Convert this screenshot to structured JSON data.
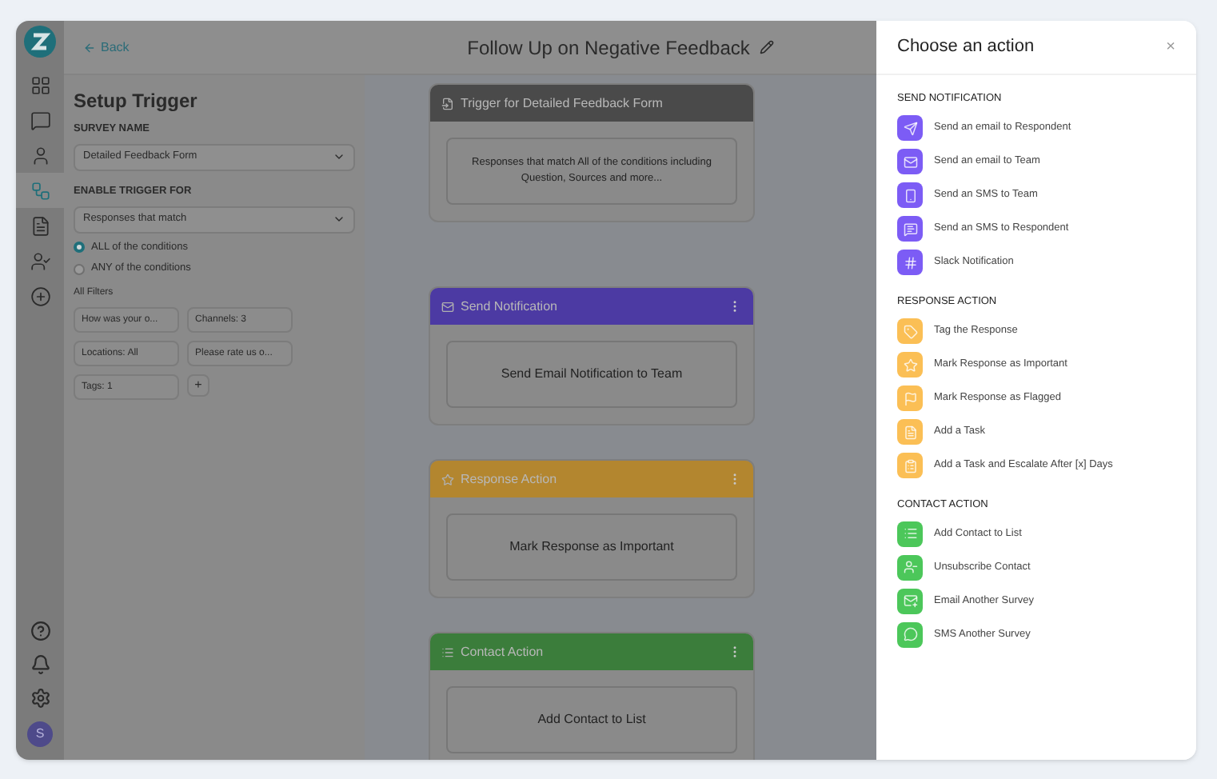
{
  "rail": {
    "items": [
      {
        "selected": false
      },
      {
        "selected": false
      },
      {
        "selected": false
      },
      {
        "selected": true
      },
      {
        "selected": false
      },
      {
        "selected": false
      },
      {
        "selected": false
      }
    ],
    "avatar": "S"
  },
  "header": {
    "back": "Back",
    "title": "Follow Up on Negative Feedback"
  },
  "setup": {
    "title": "Setup Trigger",
    "survey_label": "SURVEY NAME",
    "survey_value": "Detailed Feedback Form",
    "trigger_label": "ENABLE TRIGGER FOR",
    "trigger_value": "Responses that match",
    "radios": [
      {
        "label": "ALL of the conditions",
        "selected": true
      },
      {
        "label": "ANY of the conditions",
        "selected": false
      }
    ],
    "filters_label": "All Filters",
    "filters": [
      "How was your o...",
      "Channels: 3",
      "Locations: All",
      "Please rate us o...",
      "Tags: 1"
    ],
    "add": "+"
  },
  "flow": [
    {
      "kind": "trigger",
      "title": "Trigger for Detailed Feedback Form",
      "body": "Responses that match All of the conditions including Question, Sources and more..."
    },
    {
      "kind": "notification",
      "title": "Send Notification",
      "body": "Send Email Notification to Team"
    },
    {
      "kind": "response",
      "title": "Response Action",
      "body": "Mark Response as Important"
    },
    {
      "kind": "contact",
      "title": "Contact Action",
      "body": "Add Contact to List"
    }
  ],
  "drawer": {
    "title": "Choose an action",
    "close": "×",
    "sections": [
      {
        "kind": "notification",
        "title": "SEND NOTIFICATION",
        "items": [
          "Send an email to Respondent",
          "Send an email to Team",
          "Send an SMS to Team",
          "Send an SMS to Respondent",
          "Slack Notification"
        ]
      },
      {
        "kind": "response",
        "title": "RESPONSE ACTION",
        "items": [
          "Tag the Response",
          "Mark Response as Important",
          "Mark Response as Flagged",
          "Add a Task",
          "Add a Task and Escalate After [x] Days"
        ]
      },
      {
        "kind": "contact",
        "title": "CONTACT ACTION",
        "items": [
          "Add Contact to List",
          "Unsubscribe Contact",
          "Email Another Survey",
          "SMS Another Survey"
        ]
      }
    ]
  }
}
